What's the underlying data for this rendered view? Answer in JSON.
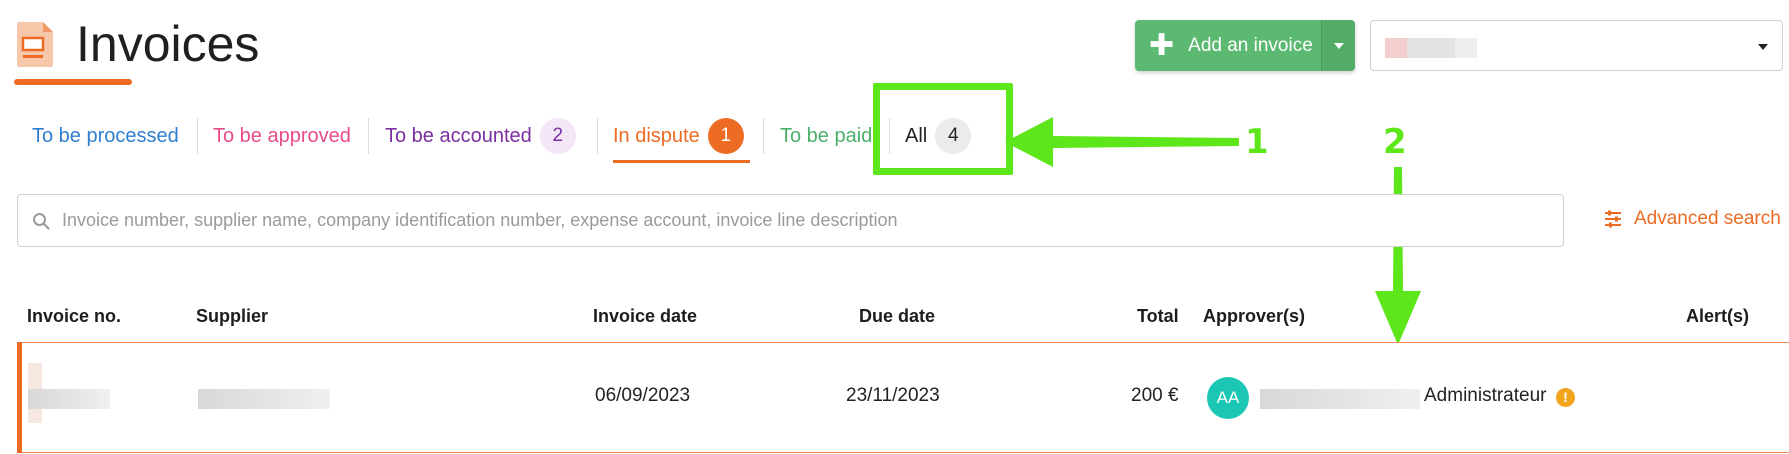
{
  "header": {
    "title": "Invoices",
    "add_button_label": "Add an invoice",
    "add_button_icon": "plus-icon",
    "company_select_value": ""
  },
  "tabs": [
    {
      "label": "To be processed",
      "color": "#2f7fcf"
    },
    {
      "label": "To be approved",
      "color": "#e84a8a"
    },
    {
      "label": "To be accounted",
      "count": "2",
      "color": "#7b2fa0"
    },
    {
      "label": "In dispute",
      "count": "1",
      "color": "#ee6b24",
      "active": true
    },
    {
      "label": "To be paid",
      "color": "#4caf6a"
    },
    {
      "label": "All",
      "count": "4",
      "color": "#222222"
    }
  ],
  "search": {
    "placeholder": "Invoice number, supplier name, company identification number, expense account, invoice line description"
  },
  "advanced_search_label": "Advanced search",
  "table": {
    "columns": [
      "Invoice no.",
      "Supplier",
      "Invoice date",
      "Due date",
      "Total",
      "Approver(s)",
      "Alert(s)"
    ],
    "rows": [
      {
        "invoice_no": "",
        "supplier": "",
        "invoice_date": "06/09/2023",
        "due_date": "23/11/2023",
        "total": "200 €",
        "approver_initials": "AA",
        "approver_role": "Administrateur",
        "alert": "!"
      }
    ]
  },
  "annotations": [
    {
      "label": "1"
    },
    {
      "label": "2"
    }
  ],
  "colors": {
    "accent": "#ee6b24",
    "primary_green": "#5cb971",
    "annotation_green": "#5de619",
    "avatar_teal": "#1cc6b5",
    "warning": "#f2a51b"
  }
}
